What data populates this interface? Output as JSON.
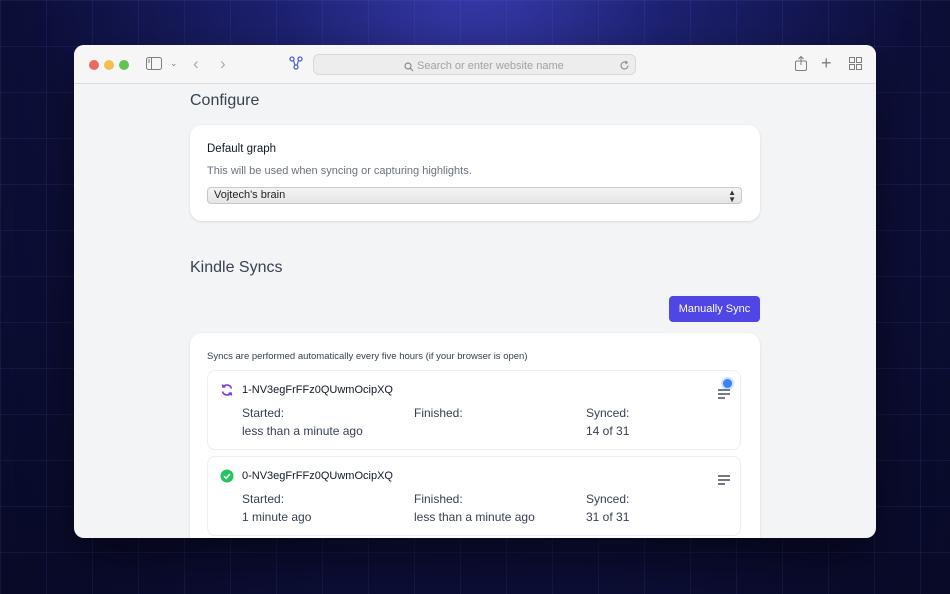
{
  "browser": {
    "address_placeholder": "Search or enter website name"
  },
  "configure": {
    "title": "Configure",
    "default_graph_label": "Default graph",
    "default_graph_help": "This will be used when syncing or capturing highlights.",
    "selected_graph": "Vojtech's brain"
  },
  "kindle": {
    "title": "Kindle Syncs",
    "manual_sync_label": "Manually Sync",
    "note": "Syncs are performed automatically every five hours (if your browser is open)",
    "started_label": "Started:",
    "finished_label": "Finished:",
    "synced_label": "Synced:",
    "syncs": [
      {
        "id": "1-NV3egFrFFz0QUwmOcipXQ",
        "status": "in-progress",
        "started": "less than a minute ago",
        "finished": "",
        "synced": "14 of 31"
      },
      {
        "id": "0-NV3egFrFFz0QUwmOcipXQ",
        "status": "complete",
        "started": "1 minute ago",
        "finished": "less than a minute ago",
        "synced": "31 of 31"
      }
    ]
  },
  "colors": {
    "accent": "#4f46e5",
    "success": "#22c55e",
    "in_progress": "#7c3aed",
    "badge": "#3b82f6"
  }
}
